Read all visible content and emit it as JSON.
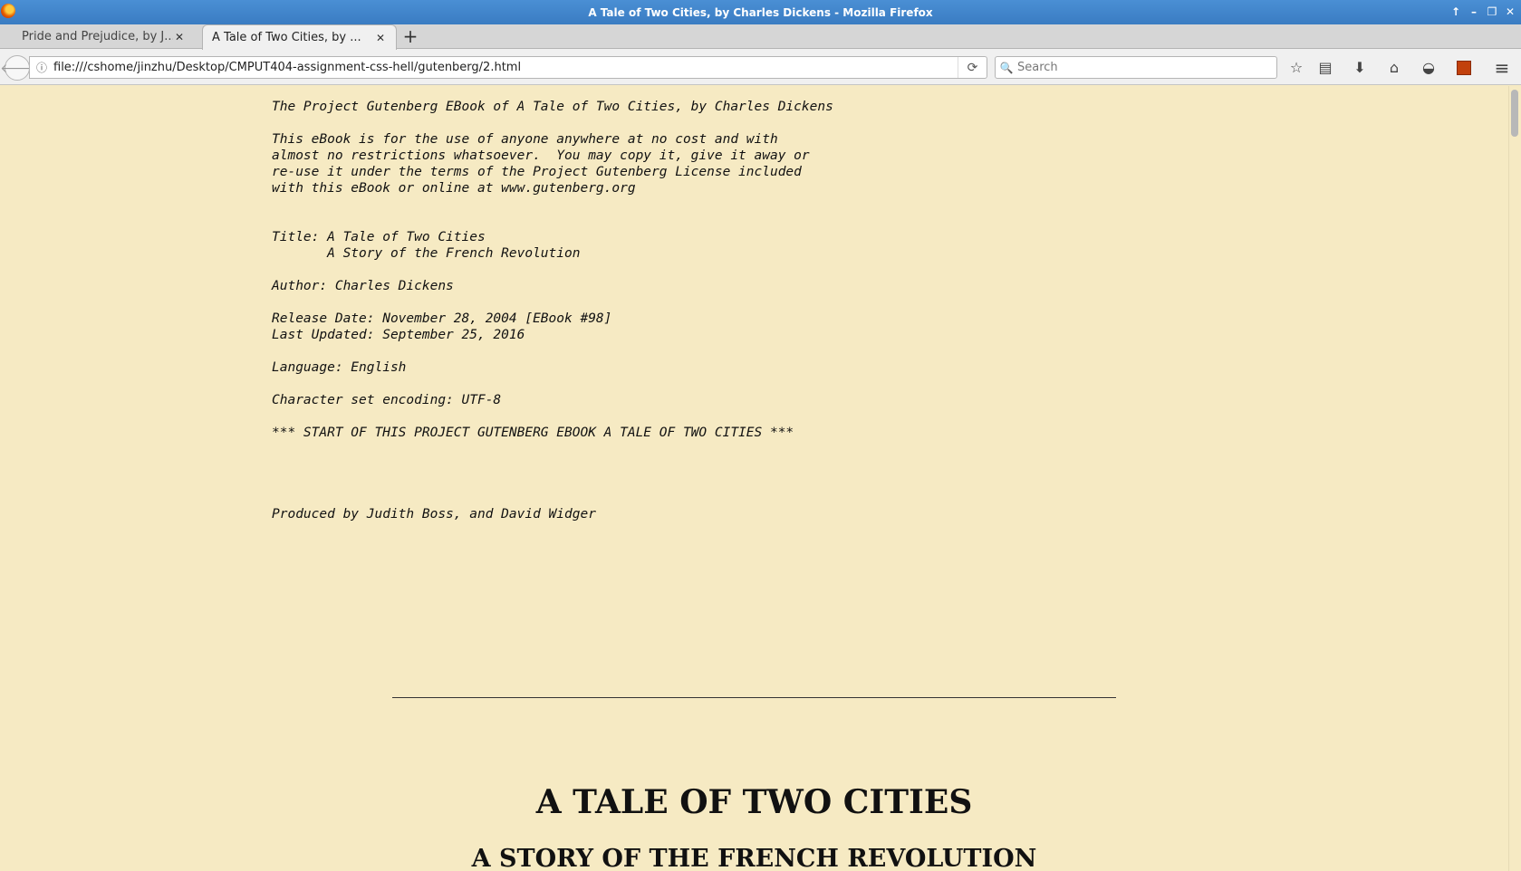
{
  "window": {
    "title": "A Tale of Two Cities, by Charles Dickens - Mozilla Firefox",
    "controls": [
      "↑",
      "–",
      "❐",
      "✕"
    ]
  },
  "tabs": [
    {
      "label": "Pride and Prejudice, by J...",
      "close": "✕"
    },
    {
      "label": "A Tale of Two Cities, by ...",
      "close": "✕"
    }
  ],
  "newtab_label": "+",
  "nav": {
    "back": "🡐",
    "info": "ⓘ",
    "url": "file:///cshome/jinzhu/Desktop/CMPUT404-assignment-css-hell/gutenberg/2.html",
    "reload": "⟳",
    "search_placeholder": "Search",
    "search_icon": "🔍",
    "bookmark_star": "☆",
    "reading_list": "▤",
    "downloads": "⬇",
    "home": "⌂",
    "pocket": "◒",
    "menu": "≡"
  },
  "page": {
    "header_lines": "The Project Gutenberg EBook of A Tale of Two Cities, by Charles Dickens\n\nThis eBook is for the use of anyone anywhere at no cost and with\nalmost no restrictions whatsoever.  You may copy it, give it away or\nre-use it under the terms of the Project Gutenberg License included\nwith this eBook or online at www.gutenberg.org\n\n\nTitle: A Tale of Two Cities\n       A Story of the French Revolution\n\nAuthor: Charles Dickens\n\nRelease Date: November 28, 2004 [EBook #98]\nLast Updated: September 25, 2016\n\nLanguage: English\n\nCharacter set encoding: UTF-8\n\n*** START OF THIS PROJECT GUTENBERG EBOOK A TALE OF TWO CITIES ***\n\n\n\n\nProduced by Judith Boss, and David Widger",
    "heading": "A TALE OF TWO CITIES",
    "subheading": "A STORY OF THE FRENCH REVOLUTION"
  },
  "colors": {
    "page_background": "#f6eac3",
    "titlebar": "#3a7cc2"
  }
}
